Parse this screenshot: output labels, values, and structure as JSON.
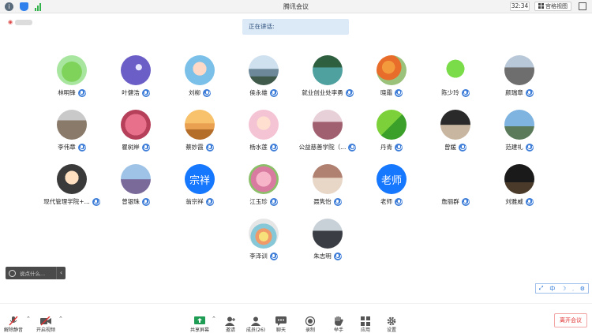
{
  "window": {
    "title": "腾讯会议",
    "timer": "32:34",
    "view_label": "宫格视图"
  },
  "speaking_label": "正在讲话:",
  "participants": [
    {
      "name": "林明锋",
      "avatar": "frog"
    },
    {
      "name": "叶健浩",
      "avatar": "rocket"
    },
    {
      "name": "刘柳",
      "avatar": "cartoon-girl"
    },
    {
      "name": "侯永雄",
      "avatar": "mountain-photo"
    },
    {
      "name": "就业创业处李勇",
      "avatar": "lake-photo"
    },
    {
      "name": "晓霜",
      "avatar": "flowers-photo"
    },
    {
      "name": "陈少玲",
      "avatar": "caterpillar"
    },
    {
      "name": "颜瑞章",
      "avatar": "man-photo"
    },
    {
      "name": "李伟章",
      "avatar": "elder-photo"
    },
    {
      "name": "瞿树岸",
      "avatar": "blossom-photo"
    },
    {
      "name": "蔡妙霞",
      "avatar": "sunset-photo"
    },
    {
      "name": "杨水莲",
      "avatar": "woman-cartoon"
    },
    {
      "name": "公益慈善学院（...",
      "avatar": "woman-hat-photo"
    },
    {
      "name": "丹青",
      "avatar": "leaf-photo"
    },
    {
      "name": "曾媛",
      "avatar": "dark-photo"
    },
    {
      "name": "范建礼",
      "avatar": "sky-photo"
    },
    {
      "name": "现代管理学院+...",
      "avatar": "man-cartoon"
    },
    {
      "name": "曾银珠",
      "avatar": "tree-photo"
    },
    {
      "name": "翁宗祥",
      "avatar": "text",
      "avatar_text": "宗祥"
    },
    {
      "name": "江玉珍",
      "avatar": "lily-photo"
    },
    {
      "name": "聂隽怡",
      "avatar": "woman-photo"
    },
    {
      "name": "老师",
      "avatar": "text",
      "avatar_text": "老师"
    },
    {
      "name": "詹丽群",
      "avatar": "none"
    },
    {
      "name": "刘雅威",
      "avatar": "night-photo"
    },
    {
      "name": "李泽训",
      "avatar": "rainbow-photo"
    },
    {
      "name": "朱志明",
      "avatar": "car-photo"
    }
  ],
  "chat": {
    "placeholder": "说点什么..."
  },
  "mini_tools": [
    "⤢",
    "中",
    "☽",
    "⸒",
    "⚙"
  ],
  "toolbar": {
    "mute": "解除静音",
    "video": "开启视频",
    "share": "共享屏幕",
    "invite": "邀请",
    "members": "成员(26)",
    "chat": "聊天",
    "record": "录制",
    "raise_hand": "举手",
    "apps": "应用",
    "settings": "设置",
    "leave": "离开会议"
  },
  "colors": {
    "accent": "#1677ff",
    "leave": "#e03030",
    "speaking_bg": "#dce9f7"
  }
}
